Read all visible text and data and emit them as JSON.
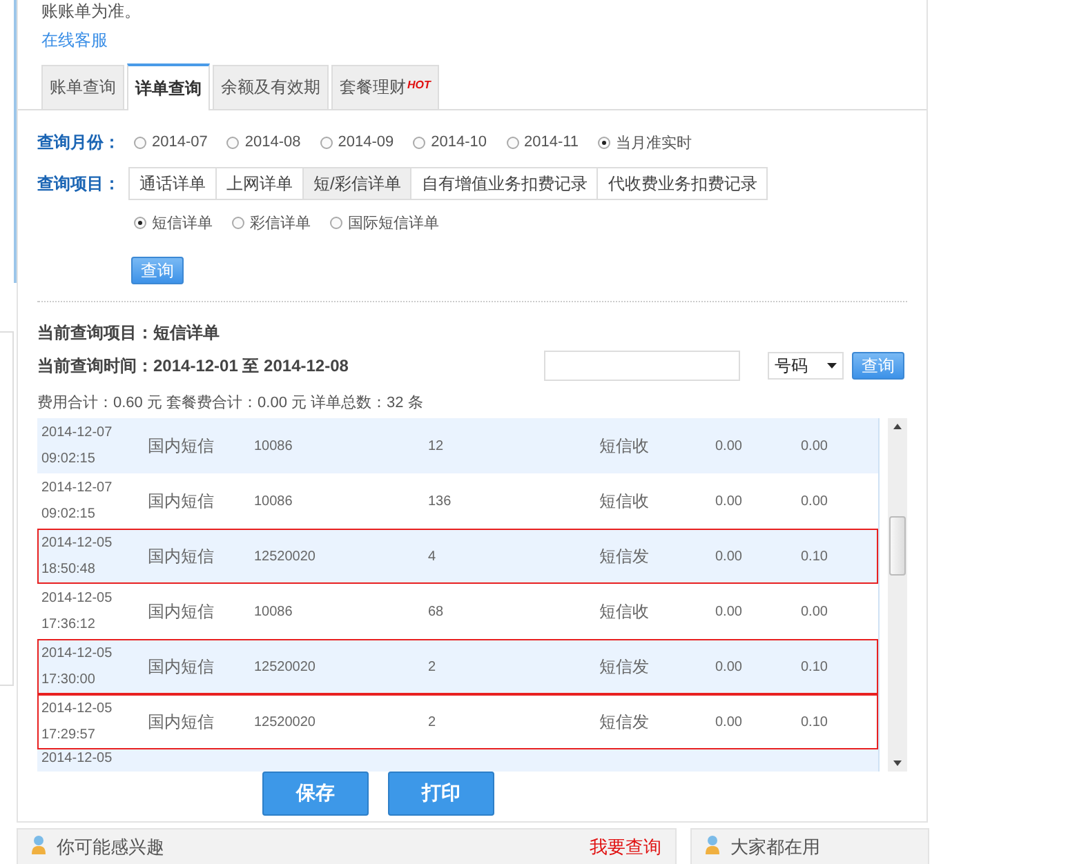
{
  "notice": {
    "text": "账账单为准。",
    "link": "在线客服"
  },
  "tabs": [
    {
      "label": "账单查询",
      "selected": false
    },
    {
      "label": "详单查询",
      "selected": true
    },
    {
      "label": "余额及有效期",
      "selected": false
    },
    {
      "label": "套餐理财",
      "badge": "HOT",
      "selected": false
    }
  ],
  "query_month": {
    "label": "查询月份：",
    "options": [
      {
        "label": "2014-07",
        "selected": false
      },
      {
        "label": "2014-08",
        "selected": false
      },
      {
        "label": "2014-09",
        "selected": false
      },
      {
        "label": "2014-10",
        "selected": false
      },
      {
        "label": "2014-11",
        "selected": false
      },
      {
        "label": "当月准实时",
        "selected": true
      }
    ]
  },
  "query_item": {
    "label": "查询项目：",
    "options": [
      {
        "label": "通话详单",
        "selected": false
      },
      {
        "label": "上网详单",
        "selected": false
      },
      {
        "label": "短/彩信详单",
        "selected": true
      },
      {
        "label": "自有增值业务扣费记录",
        "selected": false
      },
      {
        "label": "代收费业务扣费记录",
        "selected": false
      }
    ]
  },
  "sub_options": [
    {
      "label": "短信详单",
      "selected": true
    },
    {
      "label": "彩信详单",
      "selected": false
    },
    {
      "label": "国际短信详单",
      "selected": false
    }
  ],
  "query_button": "查询",
  "current_item": {
    "label": "当前查询项目：",
    "value": "短信详单"
  },
  "current_time": {
    "label": "当前查询时间：",
    "value": "2014-12-01 至 2014-12-08"
  },
  "filter": {
    "select": "号码",
    "button": "查询"
  },
  "summary": "费用合计：0.60 元 套餐费合计：0.00 元 详单总数：32 条",
  "table": {
    "rows": [
      {
        "date": "2014-12-07",
        "time": "09:02:15",
        "type": "国内短信",
        "number": "10086",
        "count": "12",
        "direction": "短信收",
        "column_6": "0.00",
        "column_7": "0.00",
        "highlighted": false
      },
      {
        "date": "2014-12-07",
        "time": "09:02:15",
        "type": "国内短信",
        "number": "10086",
        "count": "136",
        "direction": "短信收",
        "column_6": "0.00",
        "column_7": "0.00",
        "highlighted": false
      },
      {
        "date": "2014-12-05",
        "time": "18:50:48",
        "type": "国内短信",
        "number": "12520020",
        "count": "4",
        "direction": "短信发",
        "column_6": "0.00",
        "column_7": "0.10",
        "highlighted": true
      },
      {
        "date": "2014-12-05",
        "time": "17:36:12",
        "type": "国内短信",
        "number": "10086",
        "count": "68",
        "direction": "短信收",
        "column_6": "0.00",
        "column_7": "0.00",
        "highlighted": false
      },
      {
        "date": "2014-12-05",
        "time": "17:30:00",
        "type": "国内短信",
        "number": "12520020",
        "count": "2",
        "direction": "短信发",
        "column_6": "0.00",
        "column_7": "0.10",
        "highlighted": true
      },
      {
        "date": "2014-12-05",
        "time": "17:29:57",
        "type": "国内短信",
        "number": "12520020",
        "count": "2",
        "direction": "短信发",
        "column_6": "0.00",
        "column_7": "0.10",
        "highlighted": true
      }
    ],
    "partial_row": "2014-12-05"
  },
  "buttons": [
    "保存",
    "打印"
  ],
  "bottom_panels": [
    {
      "title": "你可能感兴趣",
      "link": "我要查询"
    },
    {
      "title": "大家都在用"
    }
  ]
}
